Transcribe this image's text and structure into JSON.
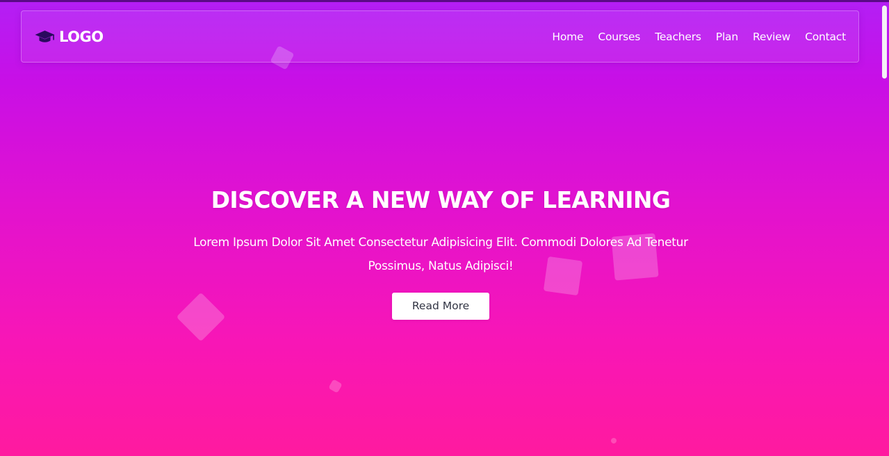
{
  "header": {
    "logo_text": "LOGO",
    "logo_icon": "graduation-cap-icon"
  },
  "nav": {
    "items": [
      {
        "label": "Home"
      },
      {
        "label": "Courses"
      },
      {
        "label": "Teachers"
      },
      {
        "label": "Plan"
      },
      {
        "label": "Review"
      },
      {
        "label": "Contact"
      }
    ]
  },
  "hero": {
    "title": "DISCOVER A NEW WAY OF LEARNING",
    "description": "Lorem Ipsum Dolor Sit Amet Consectetur Adipisicing Elit. Commodi Dolores Ad Tenetur Possimus, Natus Adipisci!",
    "button_label": "Read More"
  },
  "colors": {
    "gradient_top": "#b31ff5",
    "gradient_bottom": "#ff1a9f",
    "logo_icon": "#2a0a5e",
    "button_text": "#333645"
  }
}
